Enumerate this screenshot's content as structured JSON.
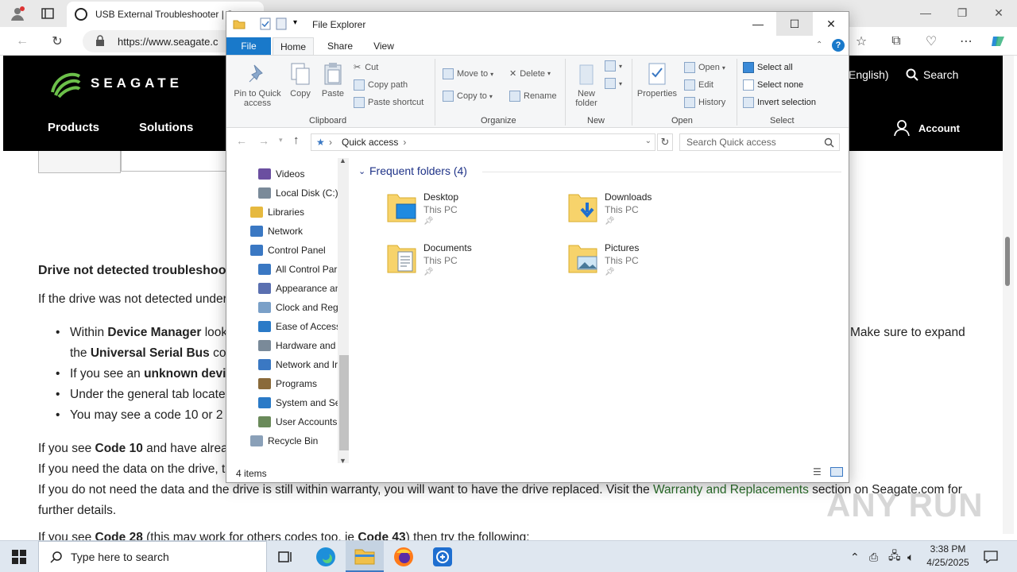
{
  "browser": {
    "tab_title": "USB External Troubleshooter | S",
    "url": "https://www.seagate.c"
  },
  "site": {
    "logo": "SEAGATE",
    "menu": [
      "Products",
      "Solutions"
    ],
    "lang": "English)",
    "search": "Search",
    "account": "Account"
  },
  "article": {
    "heading": "Drive not detected troubleshoo",
    "intro": "If the drive was not detected under",
    "bullets": [
      {
        "pre": "Within ",
        "bold": "Device Manager",
        "post": " look"
      },
      {
        "pre": "the ",
        "bold": "Universal Serial Bus",
        "post": " con"
      },
      {
        "pre": "If you see an ",
        "bold": "unknown devic",
        "post": ""
      },
      {
        "pre": "Under the general tab locate",
        "bold": "",
        "post": ""
      },
      {
        "pre": "You may see a code 10 or 2",
        "bold": "",
        "post": ""
      }
    ],
    "right_fragment": "Make sure to expand",
    "code10_pre": "If you see ",
    "code10_bold": "Code 10",
    "code10_post": " and have alrea",
    "need_data": "If you need the data on the drive, th",
    "no_need_pre": "If you do not need the data and the drive is still within warranty, you will want to have the drive replaced. Visit the ",
    "no_need_link": "Warranty and Replacements",
    "no_need_post": " section on Seagate.com for",
    "further": "further details.",
    "code28_pre": "If you see ",
    "code28_bold": "Code 28",
    "code28_mid": " (this may work for others codes too, ie ",
    "code28_bold2": "Code 43",
    "code28_post": ") then try the following:"
  },
  "explorer": {
    "title": "File Explorer",
    "tabs": [
      "File",
      "Home",
      "Share",
      "View"
    ],
    "clipboard": {
      "pin": "Pin to Quick access",
      "copy": "Copy",
      "paste": "Paste",
      "cut": "Cut",
      "copy_path": "Copy path",
      "paste_shortcut": "Paste shortcut",
      "label": "Clipboard"
    },
    "organize": {
      "move_to": "Move to",
      "copy_to": "Copy to",
      "delete": "Delete",
      "rename": "Rename",
      "label": "Organize"
    },
    "new": {
      "new_folder": "New folder",
      "label": "New"
    },
    "open": {
      "properties": "Properties",
      "open": "Open",
      "edit": "Edit",
      "history": "History",
      "label": "Open"
    },
    "select": {
      "all": "Select all",
      "none": "Select none",
      "invert": "Invert selection",
      "label": "Select"
    },
    "address": "Quick access",
    "search_placeholder": "Search Quick access",
    "nav_items": [
      {
        "label": "Videos",
        "indent": 1,
        "color": "#6b4fa0"
      },
      {
        "label": "Local Disk (C:)",
        "indent": 1,
        "color": "#7a8a99"
      },
      {
        "label": "Libraries",
        "indent": 0,
        "color": "#e6b93f"
      },
      {
        "label": "Network",
        "indent": 0,
        "color": "#3a78c3"
      },
      {
        "label": "Control Panel",
        "indent": 0,
        "color": "#3a78c3"
      },
      {
        "label": "All Control Par",
        "indent": 1,
        "color": "#3a78c3"
      },
      {
        "label": "Appearance an",
        "indent": 1,
        "color": "#5a6fb0"
      },
      {
        "label": "Clock and Regi",
        "indent": 1,
        "color": "#7aa0c8"
      },
      {
        "label": "Ease of Access",
        "indent": 1,
        "color": "#2a7ac7"
      },
      {
        "label": "Hardware and",
        "indent": 1,
        "color": "#7a8a99"
      },
      {
        "label": "Network and Ir",
        "indent": 1,
        "color": "#3a78c3"
      },
      {
        "label": "Programs",
        "indent": 1,
        "color": "#8a6a3a"
      },
      {
        "label": "System and Se",
        "indent": 1,
        "color": "#2a7ac7"
      },
      {
        "label": "User Accounts",
        "indent": 1,
        "color": "#6a8a5a"
      },
      {
        "label": "Recycle Bin",
        "indent": 0,
        "color": "#8aa0b8"
      }
    ],
    "section": "Frequent folders (4)",
    "folders": [
      {
        "name": "Desktop",
        "loc": "This PC"
      },
      {
        "name": "Downloads",
        "loc": "This PC"
      },
      {
        "name": "Documents",
        "loc": "This PC"
      },
      {
        "name": "Pictures",
        "loc": "This PC"
      }
    ],
    "status": "4 items"
  },
  "taskbar": {
    "search": "Type here to search",
    "time": "3:38 PM",
    "date": "4/25/2025"
  },
  "watermark": "ANY RUN"
}
